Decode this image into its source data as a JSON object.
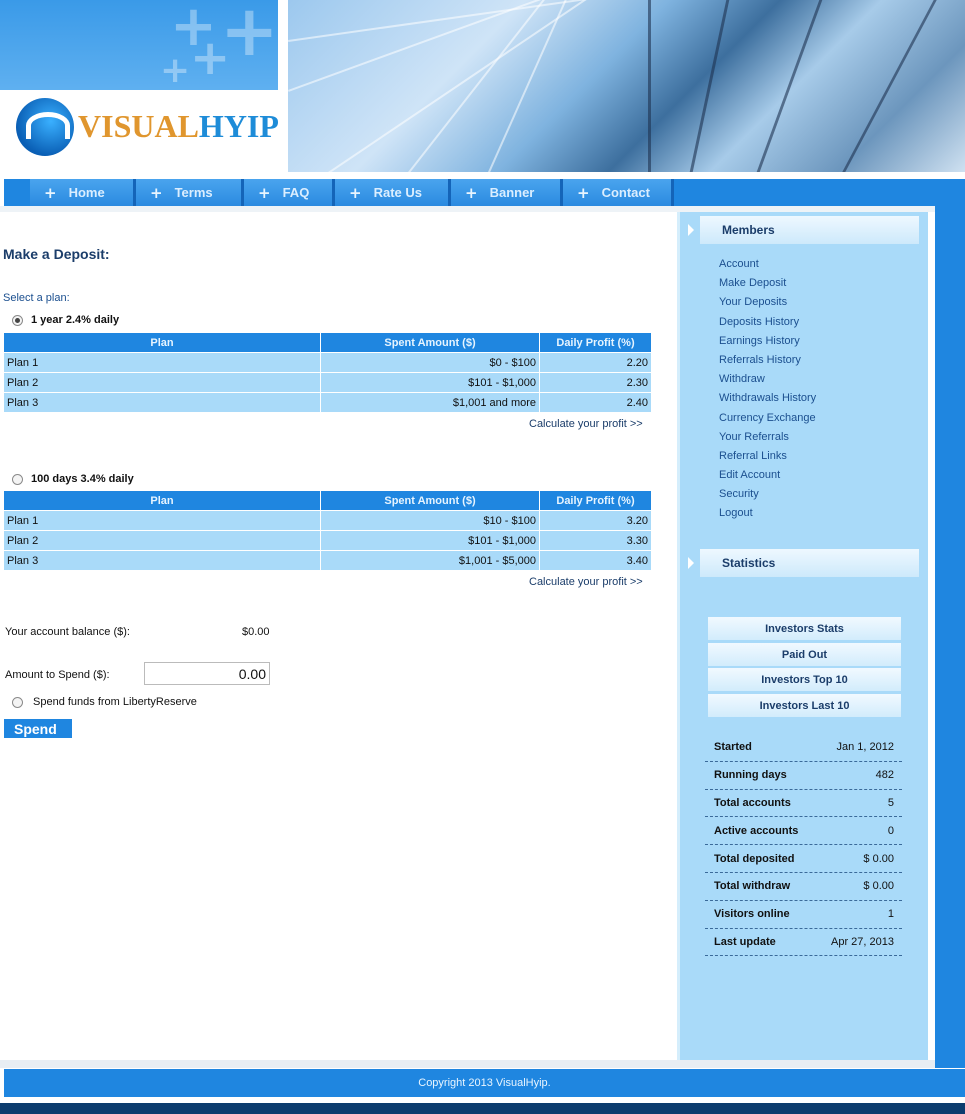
{
  "logo": {
    "text_a": "VISUAL",
    "text_b": "HYIP"
  },
  "nav": [
    "Home",
    "Terms",
    "FAQ",
    "Rate Us",
    "Banner",
    "Contact"
  ],
  "page_title": "Make a Deposit:",
  "select_plan_label": "Select a plan:",
  "plans": [
    {
      "title": "1 year 2.4% daily",
      "selected": true,
      "headers": [
        "Plan",
        "Spent Amount ($)",
        "Daily Profit (%)"
      ],
      "rows": [
        [
          "Plan 1",
          "$0 - $100",
          "2.20"
        ],
        [
          "Plan 2",
          "$101 - $1,000",
          "2.30"
        ],
        [
          "Plan 3",
          "$1,001 and more",
          "2.40"
        ]
      ],
      "calc_link": "Calculate your profit >>"
    },
    {
      "title": "100 days 3.4% daily",
      "selected": false,
      "headers": [
        "Plan",
        "Spent Amount ($)",
        "Daily Profit (%)"
      ],
      "rows": [
        [
          "Plan 1",
          "$10 - $100",
          "3.20"
        ],
        [
          "Plan 2",
          "$101 - $1,000",
          "3.30"
        ],
        [
          "Plan 3",
          "$1,001 - $5,000",
          "3.40"
        ]
      ],
      "calc_link": "Calculate your profit >>"
    }
  ],
  "balance": {
    "label": "Your account balance ($):",
    "value": "$0.00"
  },
  "amount": {
    "label": "Amount to Spend ($):",
    "value": "0.00"
  },
  "spend_source": "Spend funds from LibertyReserve",
  "spend_button": "Spend",
  "sidebar": {
    "members_title": "Members",
    "members_menu": [
      "Account",
      "Make Deposit",
      "Your Deposits",
      "Deposits History",
      "Earnings History",
      "Referrals History",
      "Withdraw",
      "Withdrawals History",
      "Currency Exchange",
      "Your Referrals",
      "Referral Links",
      "Edit Account",
      "Security",
      "Logout"
    ],
    "statistics_title": "Statistics",
    "stat_buttons": [
      "Investors Stats",
      "Paid Out",
      "Investors Top 10",
      "Investors Last 10"
    ],
    "stats": [
      {
        "k": "Started",
        "v": "Jan 1, 2012"
      },
      {
        "k": "Running days",
        "v": "482"
      },
      {
        "k": "Total accounts",
        "v": "5"
      },
      {
        "k": "Active accounts",
        "v": "0"
      },
      {
        "k": "Total deposited",
        "v": "$ 0.00"
      },
      {
        "k": "Total withdraw",
        "v": "$ 0.00"
      },
      {
        "k": "Visitors online",
        "v": "1"
      },
      {
        "k": "Last update",
        "v": "Apr 27, 2013"
      }
    ]
  },
  "footer": "Copyright 2013 VisualHyip.",
  "colors": {
    "primary_blue": "#1f86e0",
    "sidebar_bg": "#a9daf9",
    "dark_footer": "#0d3c6e",
    "logo_orange": "#e0962e"
  }
}
